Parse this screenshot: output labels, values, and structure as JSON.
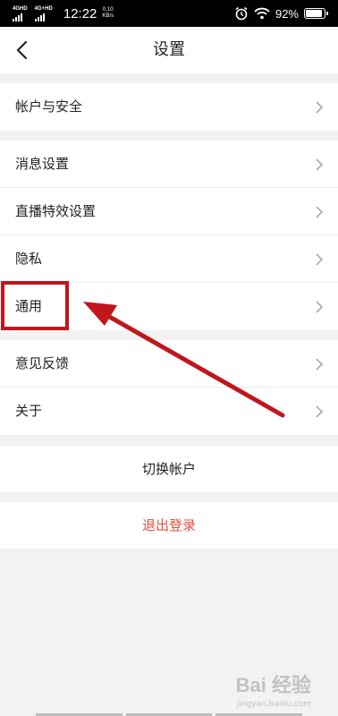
{
  "status_bar": {
    "signal_1_label": "4GHD",
    "signal_2_label": "4G+HD",
    "time": "12:22",
    "speed_value": "0.10",
    "speed_unit": "KB/s",
    "battery_percent": "92%",
    "battery_level": 0.92
  },
  "header": {
    "title": "设置"
  },
  "groups": [
    {
      "items": [
        {
          "label": "帐户与安全"
        }
      ]
    },
    {
      "items": [
        {
          "label": "消息设置"
        },
        {
          "label": "直播特效设置"
        },
        {
          "label": "隐私"
        },
        {
          "label": "通用"
        }
      ]
    },
    {
      "items": [
        {
          "label": "意见反馈"
        },
        {
          "label": "关于"
        }
      ]
    }
  ],
  "actions": {
    "switch_account": "切换帐户",
    "logout": "退出登录"
  },
  "watermark": {
    "text": "Bai 经验",
    "sub": "jingyan.baidu.com"
  },
  "colors": {
    "logout_red": "#e4503c",
    "annotation_red": "#c0161c"
  }
}
